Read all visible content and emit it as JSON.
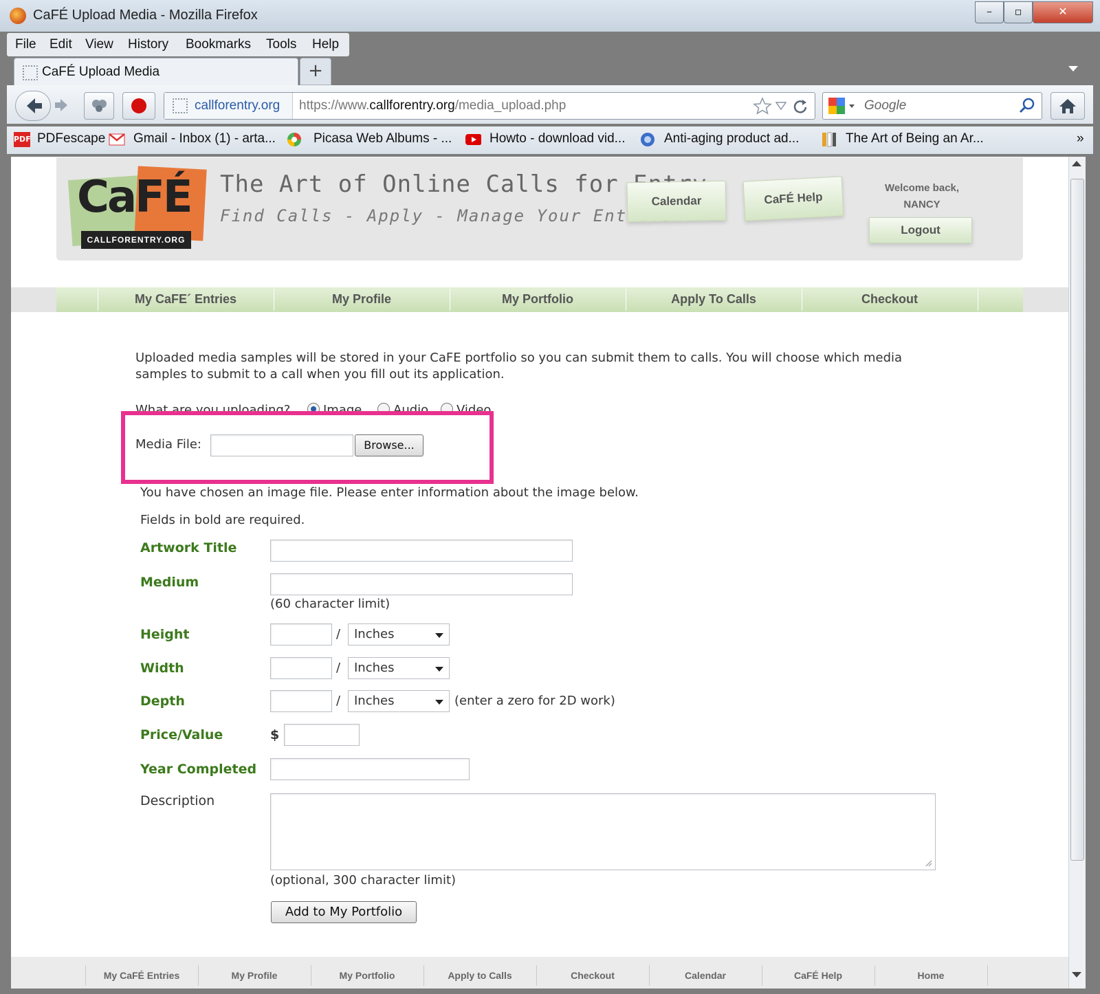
{
  "window": {
    "title": "CaFÉ Upload Media - Mozilla Firefox",
    "controls": [
      "–",
      "▫",
      "✕"
    ]
  },
  "menubar": [
    "File",
    "Edit",
    "View",
    "History",
    "Bookmarks",
    "Tools",
    "Help"
  ],
  "tab": {
    "label": "CaFÉ Upload Media",
    "new_tab": "+"
  },
  "urlbar": {
    "site": "callforentry.org",
    "url_prefix": "https://www.",
    "url_domain": "callforentry.org",
    "url_path": "/media_upload.php"
  },
  "search": {
    "placeholder": "Google"
  },
  "bookmarks": [
    "PDFescape",
    "Gmail - Inbox (1) - arta...",
    "Picasa Web Albums - ...",
    "Howto - download vid...",
    "Anti-aging product ad...",
    "The Art of Being an Ar..."
  ],
  "bookmarks_more": "»",
  "header": {
    "logo_text": "CaFÉ",
    "logo_sub": "CALLFORENTRY.ORG",
    "tagline": "The Art of Online Calls for Entry",
    "subtagline": "Find Calls - Apply - Manage Your Entries",
    "calendar": "Calendar",
    "help": "CaFÉ Help",
    "welcome": "Welcome back,",
    "user": "NANCY",
    "logout": "Logout"
  },
  "nav": [
    "My CaFE´ Entries",
    "My Profile",
    "My Portfolio",
    "Apply To Calls",
    "Checkout"
  ],
  "intro": {
    "line1": "Uploaded media samples will be stored in your CaFE portfolio so you can submit them to calls. You will choose which media",
    "line2": "samples to submit to a call when you fill out its application."
  },
  "upload_type": {
    "question": "What are you uploading?",
    "options": [
      "Image",
      "Audio",
      "Video"
    ],
    "selected": "Image"
  },
  "media_file": {
    "label": "Media File:",
    "browse": "Browse..."
  },
  "chosen_msg": "You have chosen an image file. Please enter information about the image below.",
  "required_msg": "Fields in bold are required.",
  "fields": {
    "title": "Artwork Title",
    "medium": "Medium",
    "medium_hint": "(60 character limit)",
    "height": "Height",
    "width": "Width",
    "depth": "Depth",
    "depth_hint": "(enter a zero for 2D work)",
    "unit": "Inches",
    "slash": "/",
    "price": "Price/Value",
    "currency": "$",
    "year": "Year Completed",
    "description": "Description",
    "description_hint": "(optional, 300 character limit)"
  },
  "submit": "Add to My Portfolio",
  "footer": [
    "My CaFÉ Entries",
    "My Profile",
    "My Portfolio",
    "Apply to Calls",
    "Checkout",
    "Calendar",
    "CaFÉ Help",
    "Home"
  ],
  "colors": {
    "label_green": "#3c7a1c",
    "highlight": "#e8318f",
    "nav_green": "#c9dfb4",
    "logo_orange": "#e8783a"
  }
}
